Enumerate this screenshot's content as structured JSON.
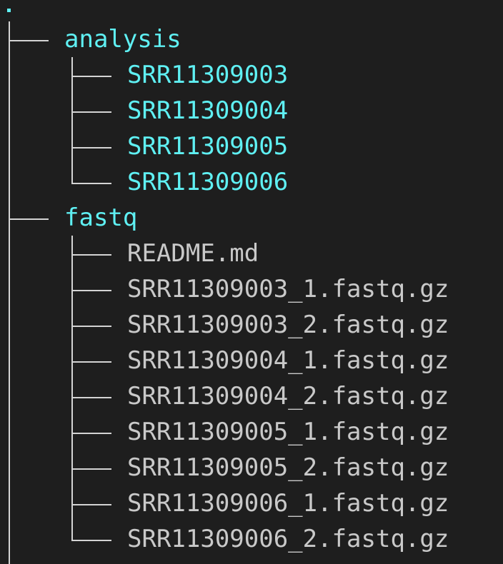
{
  "root": {
    "label": "."
  },
  "tree": [
    {
      "name": "analysis",
      "type": "directory",
      "children": [
        {
          "name": "SRR11309003",
          "type": "directory"
        },
        {
          "name": "SRR11309004",
          "type": "directory"
        },
        {
          "name": "SRR11309005",
          "type": "directory"
        },
        {
          "name": "SRR11309006",
          "type": "directory"
        }
      ]
    },
    {
      "name": "fastq",
      "type": "directory",
      "children": [
        {
          "name": "README.md",
          "type": "file"
        },
        {
          "name": "SRR11309003_1.fastq.gz",
          "type": "file"
        },
        {
          "name": "SRR11309003_2.fastq.gz",
          "type": "file"
        },
        {
          "name": "SRR11309004_1.fastq.gz",
          "type": "file"
        },
        {
          "name": "SRR11309004_2.fastq.gz",
          "type": "file"
        },
        {
          "name": "SRR11309005_1.fastq.gz",
          "type": "file"
        },
        {
          "name": "SRR11309005_2.fastq.gz",
          "type": "file"
        },
        {
          "name": "SRR11309006_1.fastq.gz",
          "type": "file"
        },
        {
          "name": "SRR11309006_2.fastq.gz",
          "type": "file"
        }
      ]
    }
  ],
  "colors": {
    "background": "#1e1e1e",
    "directory": "#5ff0f3",
    "file": "#c9c9c9",
    "tree_lines": "#d4d4d4"
  }
}
